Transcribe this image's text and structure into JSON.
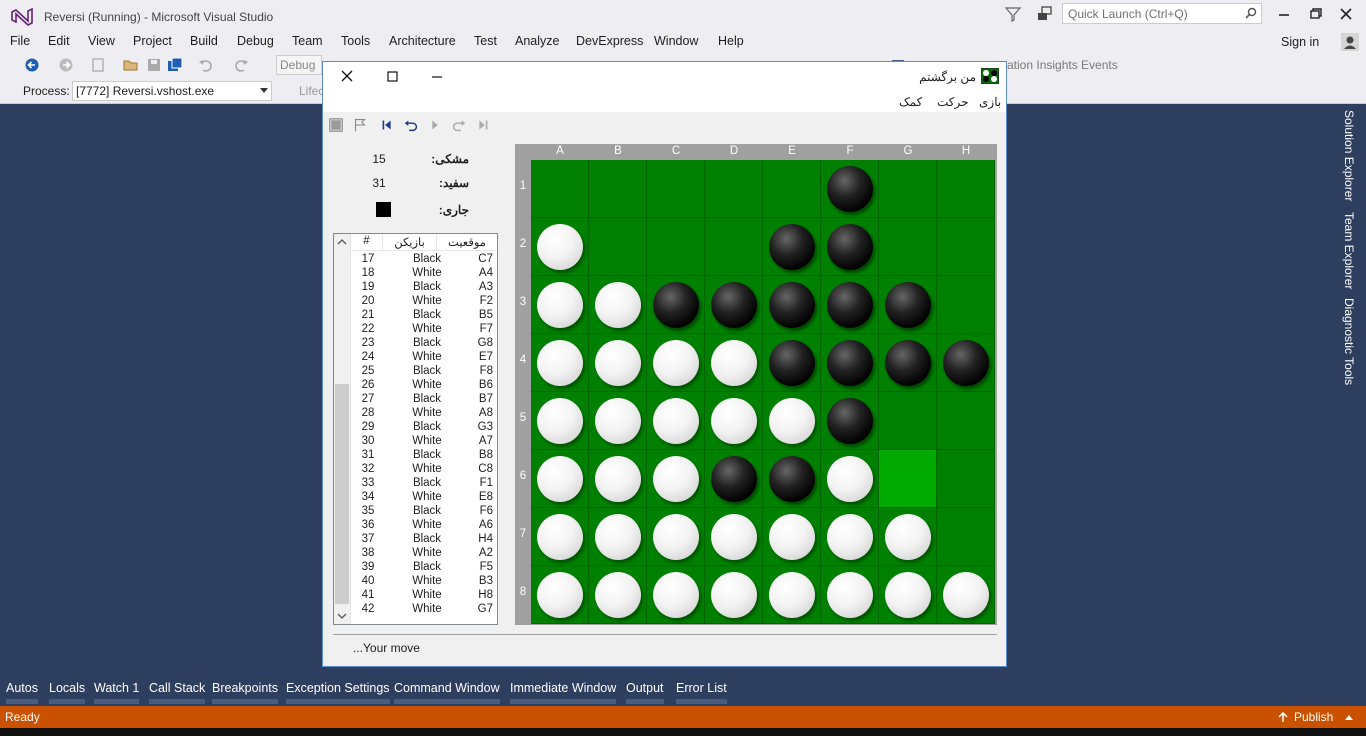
{
  "vs": {
    "title": "Reversi (Running) - Microsoft Visual Studio",
    "quick_launch_placeholder": "Quick Launch (Ctrl+Q)",
    "menus": [
      "File",
      "Edit",
      "View",
      "Project",
      "Build",
      "Debug",
      "Team",
      "Tools",
      "Architecture",
      "Test",
      "Analyze",
      "DevExpress",
      "Window",
      "Help"
    ],
    "sign_in": "Sign in",
    "debug_config": "Debug",
    "app_insights": "ation Insights Events",
    "process_label": "Process:",
    "process_value": "[7772] Reversi.vshost.exe",
    "lifecycle_label": "Lifec",
    "side_tabs": [
      "Solution Explorer",
      "Team Explorer",
      "Diagnostic Tools"
    ],
    "bottom_tabs": [
      "Autos",
      "Locals",
      "Watch 1",
      "Call Stack",
      "Breakpoints",
      "Exception Settings",
      "Command Window",
      "Immediate Window",
      "Output",
      "Error List"
    ],
    "status": "Ready",
    "publish": "Publish",
    "colors": {
      "accent": "#ca5100",
      "chrome": "#eeeef2",
      "background": "#2d3e5f"
    }
  },
  "reversi": {
    "title": "من برگشتم",
    "menus": [
      "بازی",
      "حرکت",
      "کمک"
    ],
    "score": {
      "black_label": "مشکی:",
      "black_value": "15",
      "white_label": "سفید:",
      "white_value": "31",
      "current_label": "جاری:"
    },
    "moves_headers": {
      "num": "#",
      "player": "بازیکن",
      "position": "موقعیت"
    },
    "moves": [
      {
        "num": "17",
        "player": "Black",
        "pos": "C7"
      },
      {
        "num": "18",
        "player": "White",
        "pos": "A4"
      },
      {
        "num": "19",
        "player": "Black",
        "pos": "A3"
      },
      {
        "num": "20",
        "player": "White",
        "pos": "F2"
      },
      {
        "num": "21",
        "player": "Black",
        "pos": "B5"
      },
      {
        "num": "22",
        "player": "White",
        "pos": "F7"
      },
      {
        "num": "23",
        "player": "Black",
        "pos": "G8"
      },
      {
        "num": "24",
        "player": "White",
        "pos": "E7"
      },
      {
        "num": "25",
        "player": "Black",
        "pos": "F8"
      },
      {
        "num": "26",
        "player": "White",
        "pos": "B6"
      },
      {
        "num": "27",
        "player": "Black",
        "pos": "B7"
      },
      {
        "num": "28",
        "player": "White",
        "pos": "A8"
      },
      {
        "num": "29",
        "player": "Black",
        "pos": "G3"
      },
      {
        "num": "30",
        "player": "White",
        "pos": "A7"
      },
      {
        "num": "31",
        "player": "Black",
        "pos": "B8"
      },
      {
        "num": "32",
        "player": "White",
        "pos": "C8"
      },
      {
        "num": "33",
        "player": "Black",
        "pos": "F1"
      },
      {
        "num": "34",
        "player": "White",
        "pos": "E8"
      },
      {
        "num": "35",
        "player": "Black",
        "pos": "F6"
      },
      {
        "num": "36",
        "player": "White",
        "pos": "A6"
      },
      {
        "num": "37",
        "player": "Black",
        "pos": "H4"
      },
      {
        "num": "38",
        "player": "White",
        "pos": "A2"
      },
      {
        "num": "39",
        "player": "Black",
        "pos": "F5"
      },
      {
        "num": "40",
        "player": "White",
        "pos": "B3"
      },
      {
        "num": "41",
        "player": "White",
        "pos": "H8"
      },
      {
        "num": "42",
        "player": "White",
        "pos": "G7"
      }
    ],
    "columns": [
      "A",
      "B",
      "C",
      "D",
      "E",
      "F",
      "G",
      "H"
    ],
    "rows": [
      "1",
      "2",
      "3",
      "4",
      "5",
      "6",
      "7",
      "8"
    ],
    "board": [
      ".....B..",
      "W...BB..",
      "WWBBBBB.",
      "WWWWBBBB",
      "WWWWWB..",
      "WWWBBWH.",
      "WWWWWWW.",
      "WWWWWWWW"
    ],
    "board_legend": "B = black disc, W = white disc, H = highlighted empty square, . = empty",
    "status": "...Your move",
    "colors": {
      "board": "#008000",
      "highlight": "#00aa00"
    }
  }
}
